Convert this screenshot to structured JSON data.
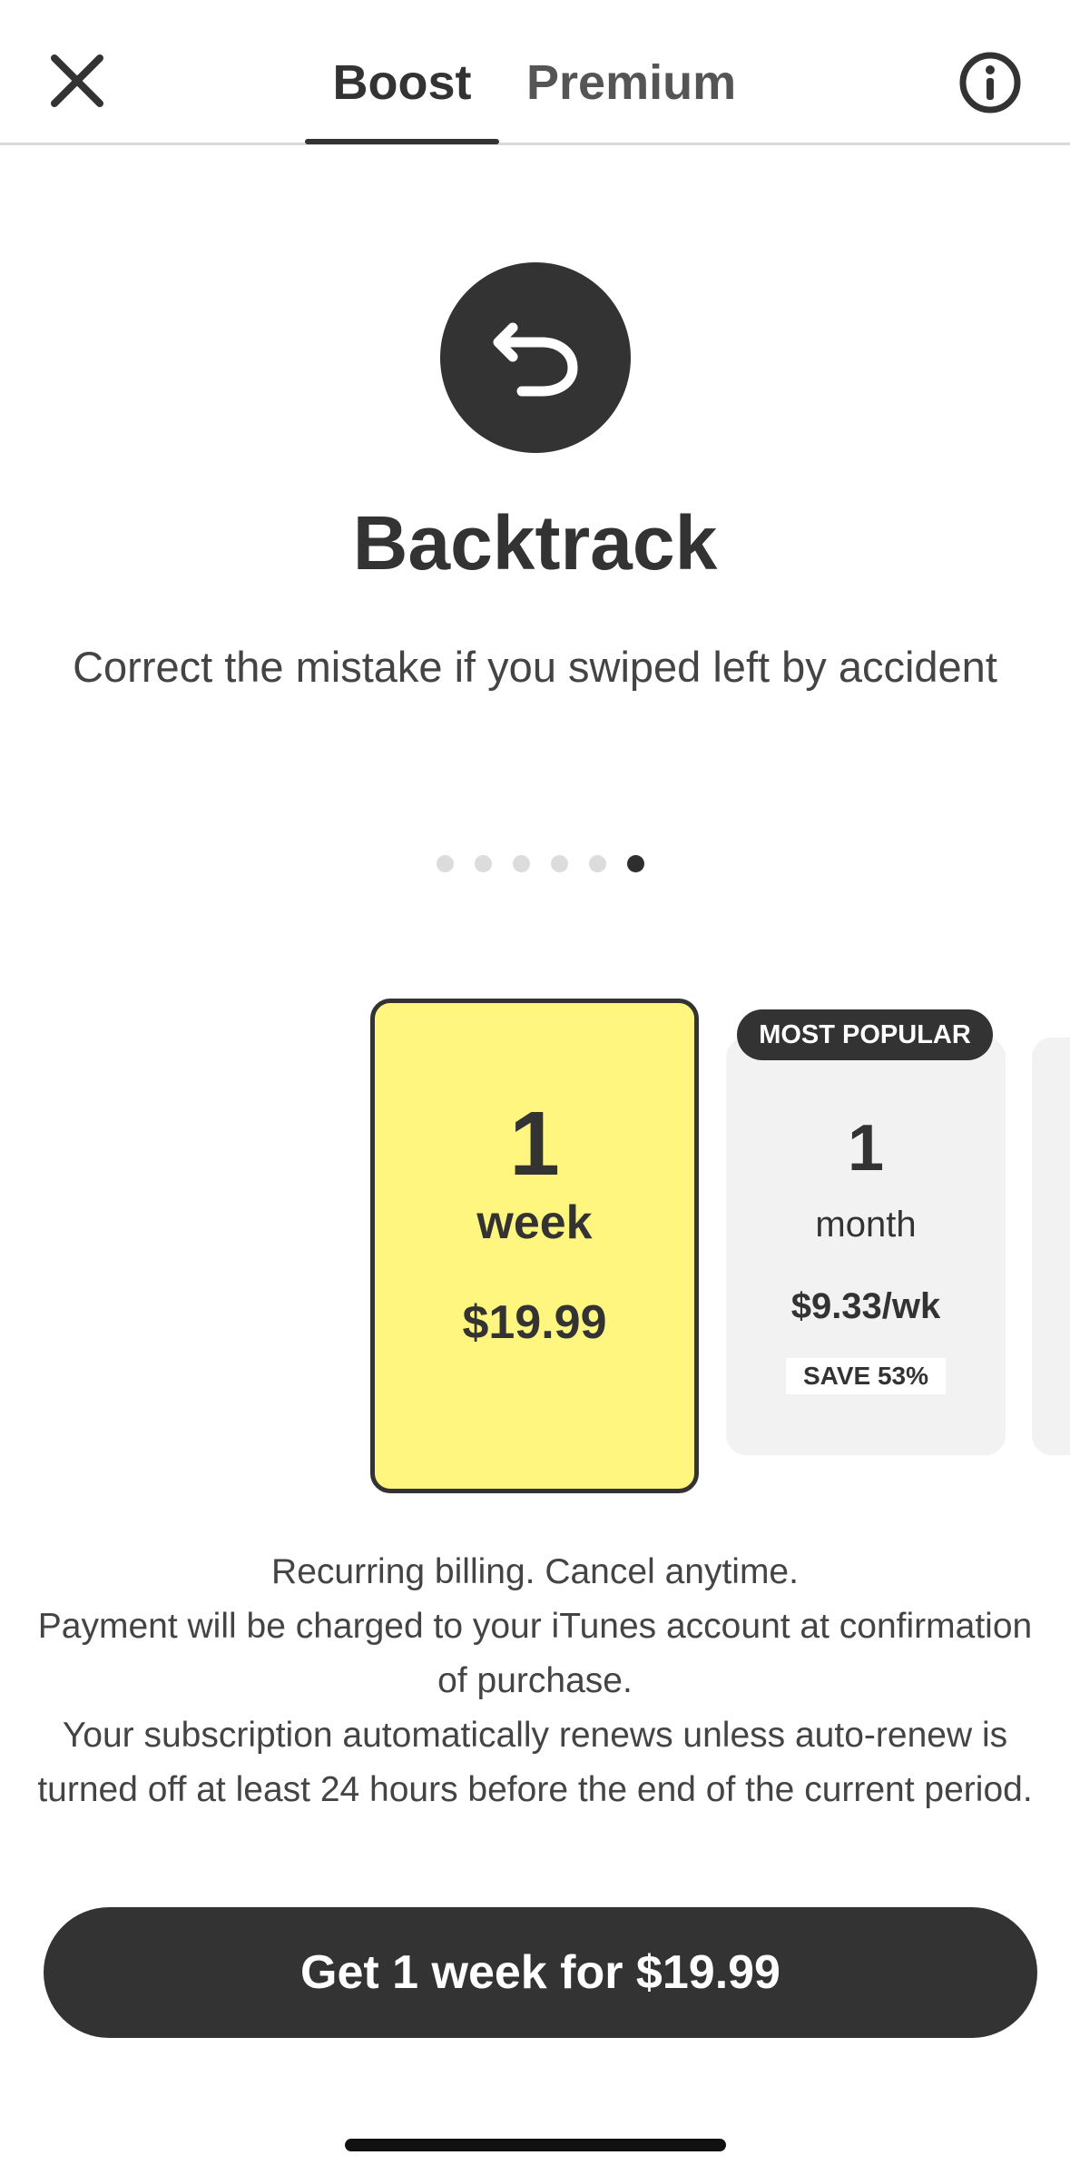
{
  "header": {
    "tabs": [
      {
        "label": "Boost",
        "active": true
      },
      {
        "label": "Premium",
        "active": false
      }
    ],
    "close_icon": "close-icon",
    "info_icon": "info-icon"
  },
  "feature": {
    "icon": "undo-arrow-icon",
    "title": "Backtrack",
    "description": "Correct the mistake if you swiped left by accident"
  },
  "carousel": {
    "dot_count": 6,
    "active_index": 5
  },
  "plans": [
    {
      "quantity": "1",
      "unit": "week",
      "price": "$19.99",
      "selected": true
    },
    {
      "badge": "MOST POPULAR",
      "quantity": "1",
      "unit": "month",
      "price": "$9.33/wk",
      "save": "SAVE 53%",
      "selected": false
    }
  ],
  "legal": [
    "Recurring billing. Cancel anytime.",
    "Payment will be charged to your iTunes account at confirmation of purchase.",
    "Your subscription automatically renews unless auto-renew is turned off at least 24 hours before the end of the current period."
  ],
  "cta": {
    "label": "Get 1 week for $19.99"
  },
  "colors": {
    "accent": "#fff680",
    "dark": "#333333",
    "card": "#f2f2f2"
  }
}
